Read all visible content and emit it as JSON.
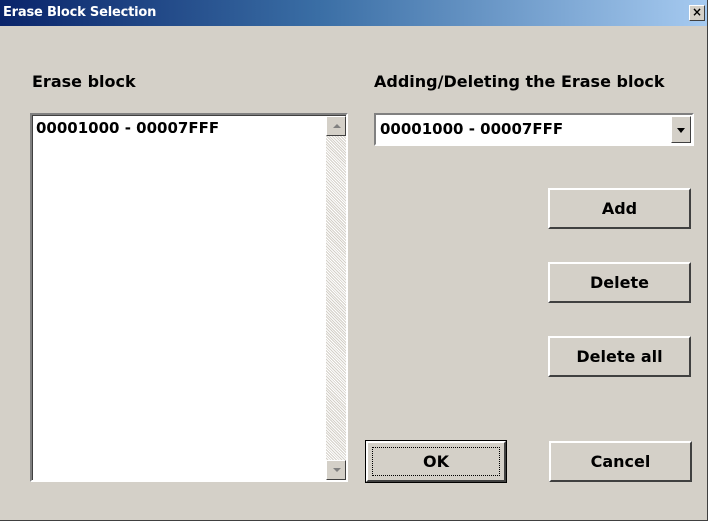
{
  "window": {
    "title": "Erase Block Selection",
    "close_symbol": "×"
  },
  "erase_block": {
    "label": "Erase block",
    "items": [
      "00001000 - 00007FFF"
    ]
  },
  "adding_deleting": {
    "label": "Adding/Deleting the Erase block",
    "selected": "00001000 - 00007FFF"
  },
  "buttons": {
    "add": "Add",
    "delete": "Delete",
    "delete_all": "Delete all",
    "ok": "OK",
    "cancel": "Cancel"
  },
  "icons": {
    "close": "close-icon",
    "scroll_up": "arrow-up-icon",
    "scroll_down": "arrow-down-icon",
    "dropdown": "chevron-down-icon"
  }
}
